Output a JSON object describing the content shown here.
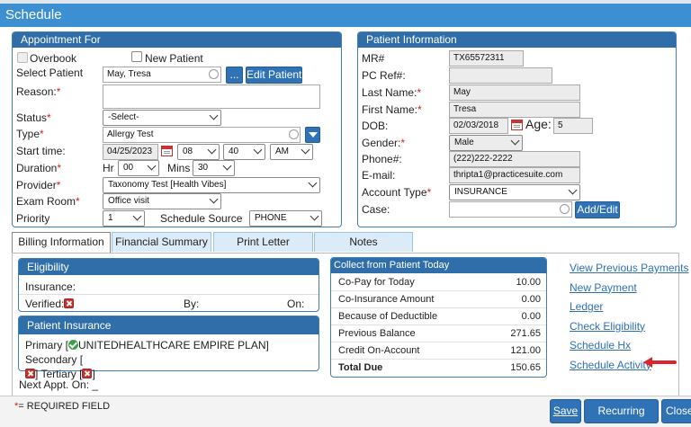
{
  "title": "Schedule",
  "appointment": {
    "header": "Appointment For",
    "overbook": "Overbook",
    "new_patient": "New Patient",
    "select_patient_label": "Select Patient",
    "patient_value": "May, Tresa",
    "more_btn": "...",
    "edit_patient_btn": "Edit Patient",
    "reason_label": "Reason:",
    "status_label": "Status",
    "status_value": "-Select-",
    "type_label": "Type",
    "type_value": "Allergy Test",
    "start_label": "Start time:",
    "start_date": "04/25/2023",
    "start_hour": "08",
    "start_min": "40",
    "start_ampm": "AM",
    "duration_label": "Duration",
    "hr_label": "Hr",
    "hr_value": "00",
    "mins_label": "Mins",
    "mins_value": "30",
    "provider_label": "Provider",
    "provider_value": "Taxonomy Test [Health Vibes]",
    "exam_label": "Exam Room",
    "exam_value": "Office visit",
    "priority_label": "Priority",
    "priority_value": "1",
    "source_label": "Schedule Source",
    "source_value": "PHONE"
  },
  "patient": {
    "header": "Patient Information",
    "mr_label": "MR#",
    "mr_value": "TX65572311",
    "pcref_label": "PC Ref#:",
    "pcref_value": "",
    "last_label": "Last Name:",
    "last_value": "May",
    "first_label": "First Name:",
    "first_value": "Tresa",
    "dob_label": "DOB:",
    "dob_value": "02/03/2018",
    "age_label": "Age:",
    "age_value": "5",
    "gender_label": "Gender:",
    "gender_value": "Male",
    "phone_label": "Phone#:",
    "phone_value": "(222)222-2222",
    "email_label": "E-mail:",
    "email_value": "thripta1@practicesuite.com",
    "acct_label": "Account Type",
    "acct_value": "INSURANCE",
    "case_label": "Case:",
    "addedit_btn": "Add/Edit"
  },
  "tabs": [
    "Billing Information",
    "Financial Summary",
    "Print Letter",
    "Notes"
  ],
  "eligibility": {
    "header": "Eligibility",
    "insurance": "Insurance:",
    "verified": "Verified:",
    "by": "By:",
    "on": "On:"
  },
  "pat_ins": {
    "header": "Patient Insurance",
    "primary": "Primary [",
    "primary_plan": "UNITEDHEALTHCARE EMPIRE PLAN]",
    "secondary": "Secondary [",
    "close_sec": "]",
    "tertiary": "Tertiary [",
    "close_ter": "]"
  },
  "next_appt": "Next Appt. On: _",
  "collect": {
    "header": "Collect from Patient Today",
    "rows": [
      {
        "k": "Co-Pay for Today",
        "v": "10.00"
      },
      {
        "k": "Co-Insurance Amount",
        "v": "0.00"
      },
      {
        "k": "Because of Deductible",
        "v": "0.00"
      },
      {
        "k": "Previous Balance",
        "v": "271.65"
      },
      {
        "k": "Credit On-Account",
        "v": "121.00"
      },
      {
        "k": "Total Due",
        "v": "150.65"
      }
    ]
  },
  "links": [
    "View Previous Payments",
    "New Payment",
    "Ledger",
    "Check Eligibility",
    "Schedule Hx",
    "Schedule Activity"
  ],
  "footer": {
    "required": "= REQUIRED FIELD",
    "required_star": "*",
    "save": "Save",
    "recurring": "Recurring Appt.",
    "close": "Close"
  },
  "colors": {
    "accent": "#2f72b6",
    "header": "#2f6ea8",
    "arrow": "#d9262c"
  }
}
